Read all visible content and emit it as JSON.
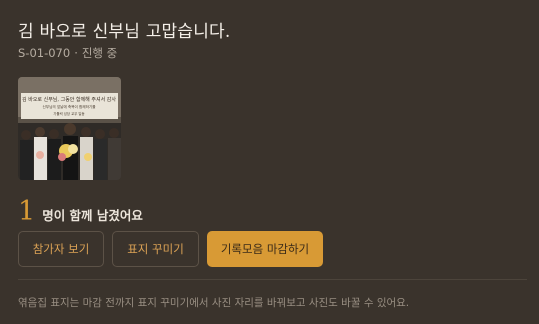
{
  "header": {
    "title": "김 바오로 신부님 고맙습니다.",
    "code": "S-01-070",
    "separator": "·",
    "status": "진행 중"
  },
  "photo": {
    "banner_line1": "김 바오로 신부님, 그동안 함께해 주셔서 감사",
    "banner_line2": "신부님의 앞날에 축복이 함께하기를",
    "banner_line3": "가톨릭 성당 교우 일동"
  },
  "participants": {
    "count": "1",
    "label": "명이 함께 남겼어요"
  },
  "buttons": {
    "view_participants": "참가자 보기",
    "decorate_cover": "표지 꾸미기",
    "close_collection": "기록모음 마감하기"
  },
  "footer": {
    "notice": "엮음집 표지는 마감 전까지 표지 꾸미기에서 사진 자리를 바꿔보고 사진도 바꿀 수 있어요."
  },
  "colors": {
    "background": "#3a332c",
    "accent": "#d89a35",
    "muted_text": "#b5aca1"
  }
}
